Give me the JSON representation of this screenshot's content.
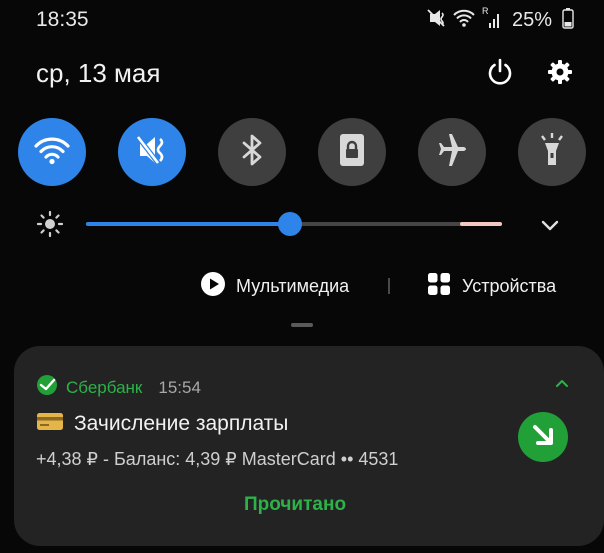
{
  "status_bar": {
    "time": "18:35",
    "battery_percent": "25%",
    "icons": [
      "mute-vibrate-icon",
      "wifi-icon",
      "signal-icon",
      "battery-icon"
    ],
    "signal_tag": "R"
  },
  "header": {
    "date": "ср, 13 мая",
    "buttons": [
      "power-icon",
      "gear-icon"
    ]
  },
  "quick_tiles": [
    {
      "name": "wifi",
      "icon": "wifi-icon",
      "on": true
    },
    {
      "name": "sound-mode",
      "icon": "mute-vibrate-icon",
      "on": true
    },
    {
      "name": "bluetooth",
      "icon": "bluetooth-icon",
      "on": false
    },
    {
      "name": "rotation-lock",
      "icon": "lock-icon",
      "on": false
    },
    {
      "name": "airplane-mode",
      "icon": "airplane-icon",
      "on": false
    },
    {
      "name": "flashlight",
      "icon": "flashlight-icon",
      "on": false
    }
  ],
  "brightness": {
    "level": 0.49,
    "icon": "sun-icon",
    "expand_icon": "chevron-down-icon"
  },
  "media": {
    "multimedia_label": "Мультимедиа",
    "devices_label": "Устройства"
  },
  "notification": {
    "app_name": "Сбербанк",
    "time": "15:54",
    "title": "Зачисление зарплаты",
    "text": "+4,38 ₽ - Баланс: 4,39 ₽ MasterCard •• 4531",
    "action_label": "Прочитано",
    "colors": {
      "accent": "#2db24a",
      "icon_bg": "#21a038"
    }
  },
  "colors": {
    "active_tile": "#2e84e8",
    "inactive_tile": "#3f3f3f",
    "background": "#070707"
  }
}
